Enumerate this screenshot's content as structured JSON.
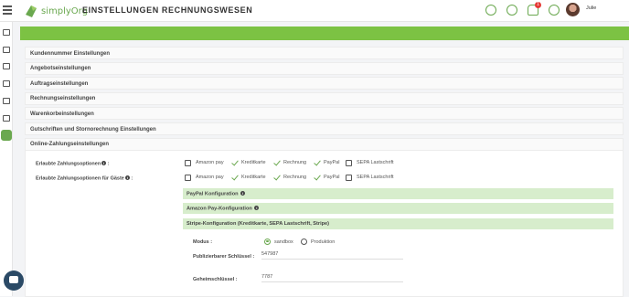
{
  "app": {
    "logo_text": "simplyOrg",
    "page_title": "EINSTELLUNGEN RECHNUNGSWESEN",
    "notification_count": "1",
    "user_name": "Julie"
  },
  "sections": [
    {
      "label": "Kundennummer Einstellungen"
    },
    {
      "label": "Angebotseinstellungen"
    },
    {
      "label": "Auftragseinstellungen"
    },
    {
      "label": "Rechnungseinstellungen"
    },
    {
      "label": "Warenkorbeinstellungen"
    },
    {
      "label": "Gutschriften und Stornorechnung Einstellungen"
    },
    {
      "label": "Online-Zahlungseinstellungen"
    }
  ],
  "payment": {
    "allowed_label": "Erlaubte Zahlungsoptionen",
    "guest_label": "Erlaubte Zahlungsoptionen für Gäste",
    "options": [
      "Amazon pay",
      "Kreditkarte",
      "Rechnung",
      "PayPal",
      "SEPA Lastschrift"
    ],
    "allowed_checked": [
      false,
      true,
      true,
      true,
      false
    ],
    "guest_checked": [
      false,
      true,
      true,
      true,
      false
    ]
  },
  "configs": {
    "paypal": "PayPal Konfiguration",
    "amazon": "Amazon Pay-Konfiguration",
    "stripe": "Stripe-Konfiguration (Kreditkarte, SEPA Lastschrift, Stripe)"
  },
  "stripe_form": {
    "mode_label": "Modus :",
    "mode_options": [
      "sandbox",
      "Produktion"
    ],
    "mode_selected": "sandbox",
    "public_key_label": "Publizierbarer Schlüssel :",
    "public_key_value": "547987",
    "secret_key_label": "Geheimschlüssel :",
    "secret_key_value": "7787"
  },
  "colors": {
    "accent": "#7cc243",
    "config_bg": "#d7edcc",
    "chat": "#2b4a66"
  }
}
